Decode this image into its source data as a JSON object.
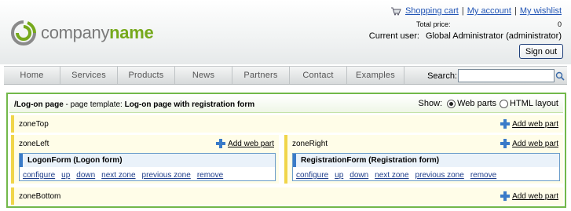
{
  "brand": {
    "company": "company",
    "name": "name"
  },
  "header": {
    "shopping_cart": "Shopping cart",
    "my_account": "My account",
    "my_wishlist": "My wishlist",
    "sep": "|",
    "total_price_label": "Total price:",
    "total_price_value": "0",
    "current_user_label": "Current user:",
    "current_user_value": "Global Administrator (administrator)",
    "signout_label": "Sign out"
  },
  "menu": {
    "items": [
      "Home",
      "Services",
      "Products",
      "News",
      "Partners",
      "Contact",
      "Examples"
    ],
    "search_label": "Search:",
    "search_value": ""
  },
  "page": {
    "path": "/Log-on page",
    "template_label": " - page template: ",
    "template_name": "Log-on page with registration form",
    "show_label": "Show:",
    "show_options": [
      "Web parts",
      "HTML layout"
    ],
    "show_selected": "Web parts"
  },
  "zones": {
    "top": {
      "label": "zoneTop",
      "add": "Add web part"
    },
    "left": {
      "label": "zoneLeft",
      "add": "Add web part",
      "webpart": {
        "title": "LogonForm (Logon form)"
      }
    },
    "right": {
      "label": "zoneRight",
      "add": "Add web part",
      "webpart": {
        "title": "RegistrationForm (Registration form)"
      }
    },
    "bottom": {
      "label": "zoneBottom",
      "add": "Add web part"
    }
  },
  "webpart_actions": [
    "configure",
    "up",
    "down",
    "next zone",
    "previous zone",
    "remove"
  ],
  "colors": {
    "brand_green": "#76a91c",
    "zone_bar": "#f0d54a",
    "webpart_bar": "#3a7bc8",
    "page_border": "#72b84a"
  }
}
